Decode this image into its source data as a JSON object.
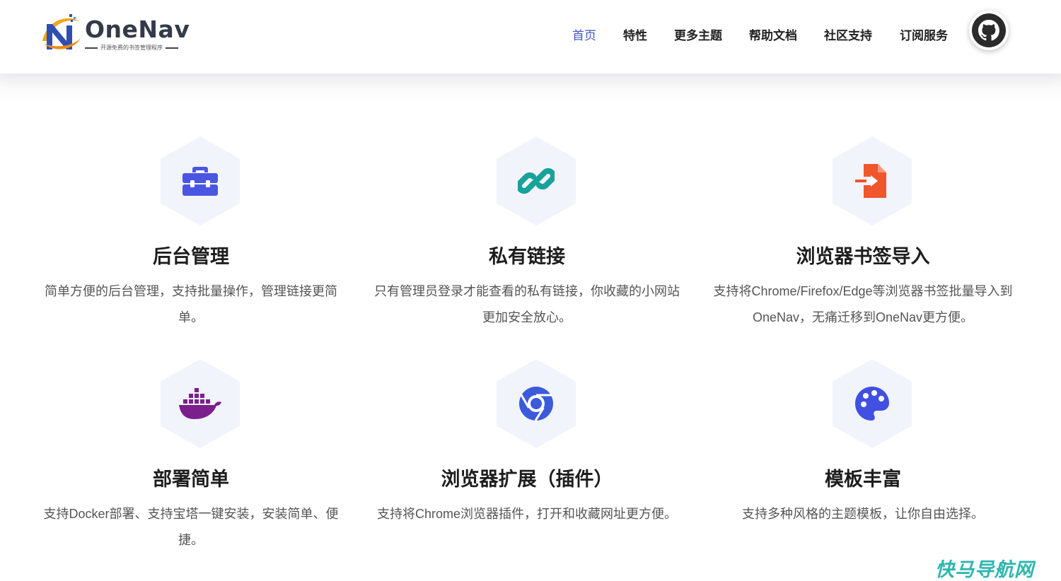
{
  "brand": {
    "name": "OneNav",
    "tagline": "开源免费的书签管理程序",
    "colors": {
      "nav_active": "#3b56c8",
      "hex_bg": "#f2f4fc",
      "watermark": "#2fb6b0"
    }
  },
  "nav": {
    "items": [
      {
        "label": "首页",
        "active": true
      },
      {
        "label": "特性",
        "active": false
      },
      {
        "label": "更多主题",
        "active": false
      },
      {
        "label": "帮助文档",
        "active": false
      },
      {
        "label": "社区支持",
        "active": false
      },
      {
        "label": "订阅服务",
        "active": false
      }
    ],
    "github_icon": "github-icon"
  },
  "features": [
    {
      "icon": "toolbox-icon",
      "icon_color": "#4a56e2",
      "title": "后台管理",
      "desc": "简单方便的后台管理，支持批量操作，管理链接更简单。"
    },
    {
      "icon": "link-icon",
      "icon_color": "#16a39a",
      "title": "私有链接",
      "desc": "只有管理员登录才能查看的私有链接，你收藏的小网站更加安全放心。"
    },
    {
      "icon": "file-import-icon",
      "icon_color": "#f0562c",
      "title": "浏览器书签导入",
      "desc": "支持将Chrome/Firefox/Edge等浏览器书签批量导入到OneNav，无痛迁移到OneNav更方便。"
    },
    {
      "icon": "docker-icon",
      "icon_color": "#7b1f8c",
      "title": "部署简单",
      "desc": "支持Docker部署、支持宝塔一键安装，安装简单、便捷。"
    },
    {
      "icon": "chrome-icon",
      "icon_color": "#3b5bdb",
      "title": "浏览器扩展（插件）",
      "desc": "支持将Chrome浏览器插件，打开和收藏网址更方便。"
    },
    {
      "icon": "palette-icon",
      "icon_color": "#4050e0",
      "title": "模板丰富",
      "desc": "支持多种风格的主题模板，让你自由选择。"
    }
  ],
  "watermark": "快马导航网"
}
